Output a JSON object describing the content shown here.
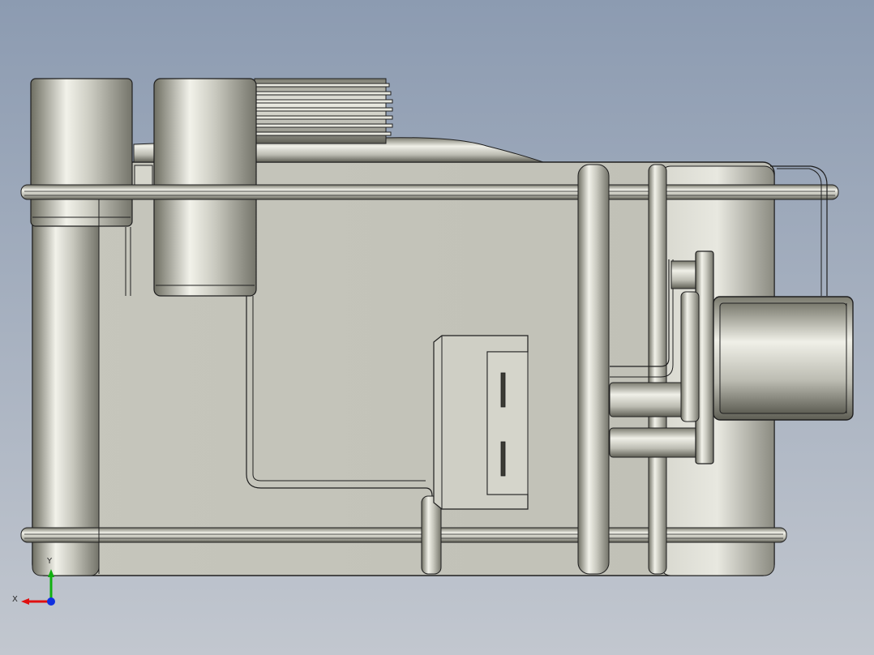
{
  "viewport": {
    "background_top": "#8c9bb1",
    "background_bottom": "#c2c7cf"
  },
  "model": {
    "body_color": "#c5c5bb",
    "edge_color": "#1f1f1f",
    "shade_dark": "#6e6e62",
    "shade_light": "#f2f2ea"
  },
  "triad": {
    "x_label": "X",
    "y_label": "Y",
    "x_axis_color": "#e01010",
    "y_axis_color": "#10b010",
    "z_axis_color": "#1030e0"
  }
}
